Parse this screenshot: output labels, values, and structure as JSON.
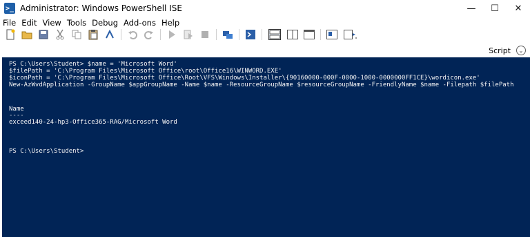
{
  "window": {
    "title": "Administrator: Windows PowerShell ISE",
    "icon": "powershell-ise-icon",
    "controls": {
      "minimize": "—",
      "maximize": "☐",
      "close": "✕"
    }
  },
  "menu": [
    "File",
    "Edit",
    "View",
    "Tools",
    "Debug",
    "Add-ons",
    "Help"
  ],
  "toolbar": {
    "icons": [
      "new-file-icon",
      "open-folder-icon",
      "save-icon",
      "cut-icon",
      "copy-icon",
      "paste-icon",
      "clear-console-icon",
      "undo-icon",
      "redo-icon",
      "run-icon",
      "run-selection-icon",
      "stop-icon",
      "new-remote-tab-icon",
      "start-powershell-icon",
      "layout-script-top-icon",
      "layout-script-right-icon",
      "layout-script-max-icon",
      "show-script-pane-icon",
      "show-commands-icon"
    ]
  },
  "scriptbar": {
    "label": "Script",
    "toggle": "⌄"
  },
  "console": {
    "lines": [
      "PS C:\\Users\\Student> $name = 'Microsoft Word'",
      "$filePath = 'C:\\Program Files\\Microsoft Office\\root\\Office16\\WINWORD.EXE'",
      "$iconPath = 'C:\\Program Files\\Microsoft Office\\Root\\VFS\\Windows\\Installer\\{90160000-000F-0000-1000-0000000FF1CE}\\wordicon.exe'",
      "New-AzWvdApplication -GroupName $appGroupName -Name $name -ResourceGroupName $resourceGroupName -FriendlyName $name -Filepath $filePath",
      "",
      "",
      "Name",
      "----",
      "exceed140-24-hp3-Office365-RAG/Microsoft Word",
      "",
      "",
      "",
      "PS C:\\Users\\Student>"
    ]
  }
}
